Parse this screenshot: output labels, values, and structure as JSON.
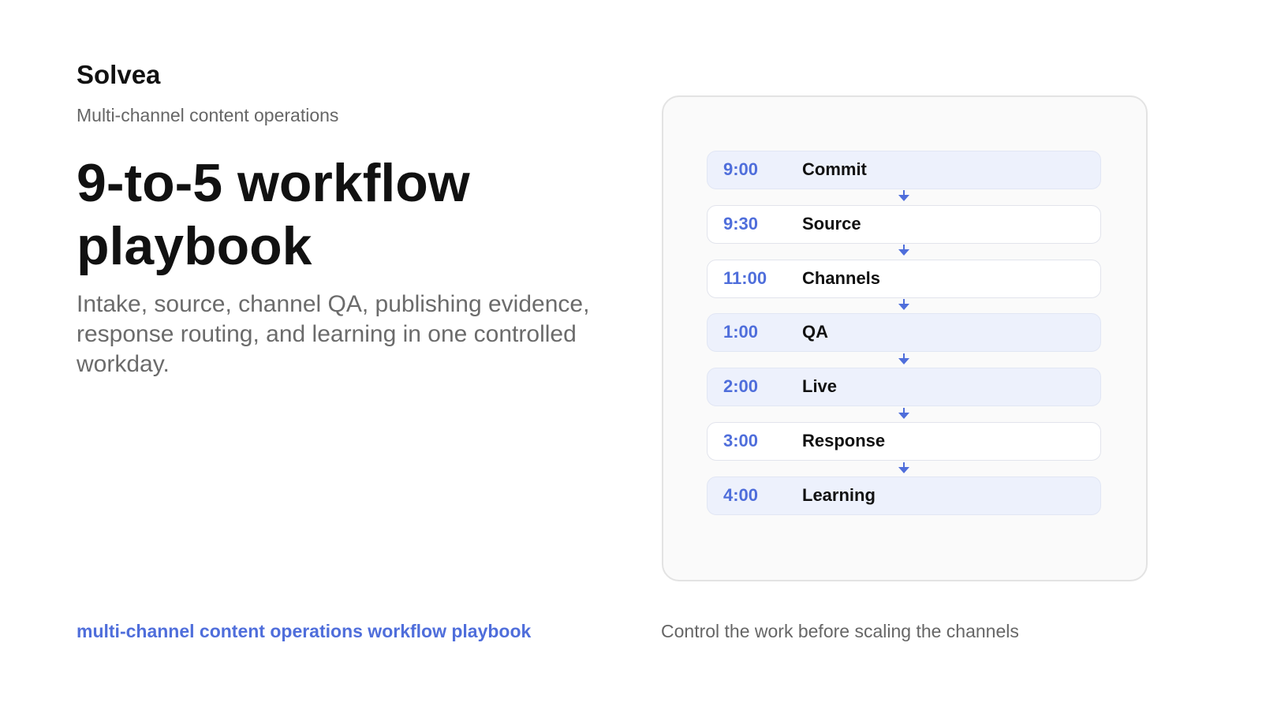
{
  "brand": {
    "name": "Solvea",
    "tagline": "Multi-channel content operations"
  },
  "hero": {
    "headline_line1": "9-to-5 workflow",
    "headline_line2": "playbook",
    "lede": "Intake, source, channel QA, publishing evidence, response routing, and learning in one controlled workday."
  },
  "workflow": {
    "accent_color": "#4f6edb",
    "highlight_color": "#edf1fc",
    "arrow_icon": "arrow-down-icon",
    "steps": [
      {
        "time": "9:00",
        "label": "Commit",
        "highlighted": true
      },
      {
        "time": "9:30",
        "label": "Source",
        "highlighted": false
      },
      {
        "time": "11:00",
        "label": "Channels",
        "highlighted": false
      },
      {
        "time": "1:00",
        "label": "QA",
        "highlighted": true
      },
      {
        "time": "2:00",
        "label": "Live",
        "highlighted": true
      },
      {
        "time": "3:00",
        "label": "Response",
        "highlighted": false
      },
      {
        "time": "4:00",
        "label": "Learning",
        "highlighted": true
      }
    ]
  },
  "footer": {
    "left": "multi-channel content operations workflow playbook",
    "right": "Control the work before scaling the channels"
  }
}
